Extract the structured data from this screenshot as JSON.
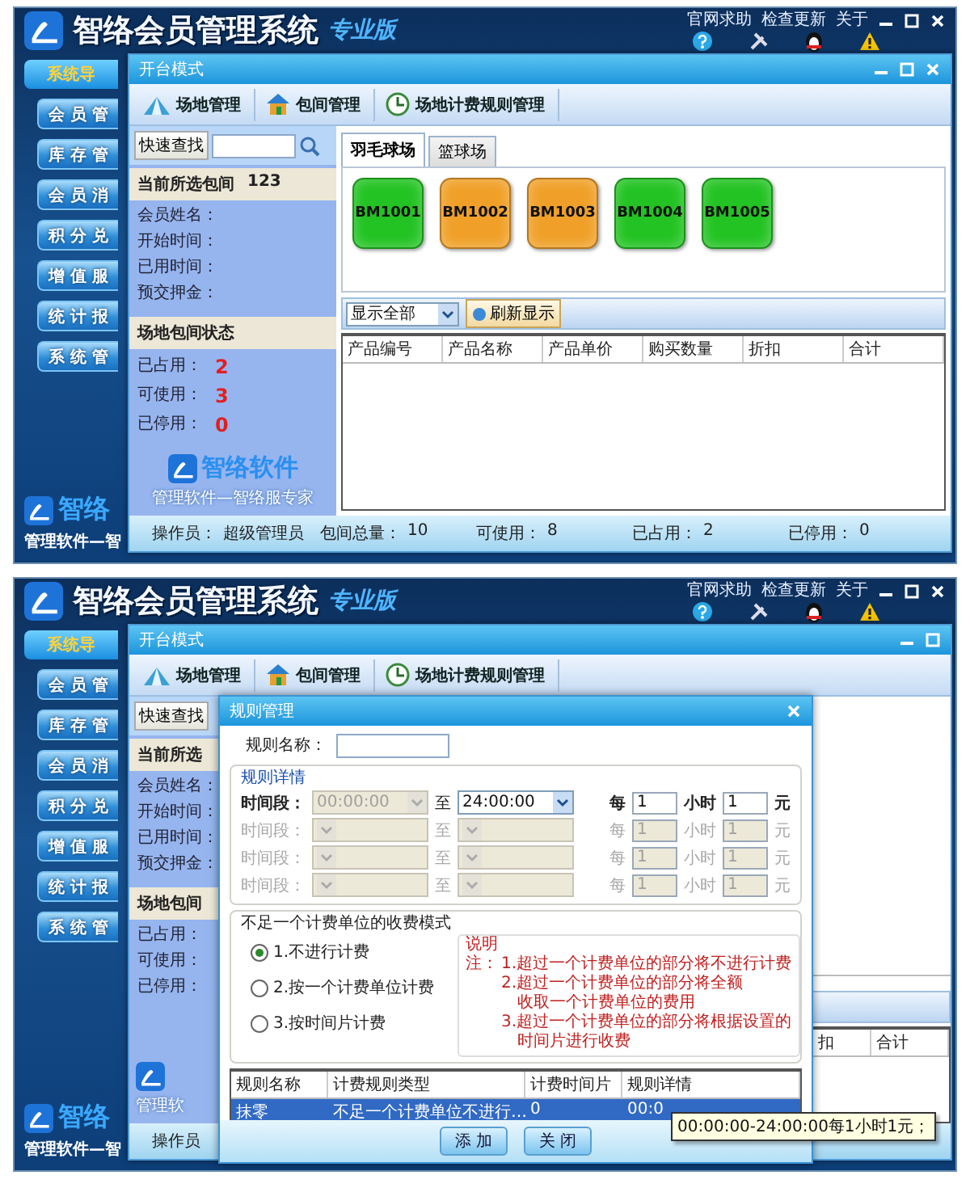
{
  "screens": [
    {
      "app": {
        "title": "智络会员管理系统",
        "edition": "专业版",
        "links": [
          "官网求助",
          "检查更新",
          "关于"
        ],
        "nav_header": "系统导",
        "nav": [
          "会 员 管",
          "库 存 管",
          "会 员 消",
          "积 分 兑",
          "增 值 服",
          "统 计 报",
          "系 统 管"
        ],
        "brand": "智络",
        "tagline": "管理软件—智"
      },
      "window": {
        "title": "开台模式",
        "toolbar": [
          "场地管理",
          "包间管理",
          "场地计费规则管理"
        ],
        "search_label": "快速查找",
        "current_label": "当前所选包间",
        "current_value": "123",
        "fields": [
          "会员姓名：",
          "开始时间：",
          "已用时间：",
          "预交押金："
        ],
        "status_header": "场地包间状态",
        "stats": [
          {
            "label": "已占用：",
            "value": "2"
          },
          {
            "label": "可使用：",
            "value": "3"
          },
          {
            "label": "已停用：",
            "value": "0"
          }
        ],
        "logo": "智络软件",
        "logo_tagline": "管理软件—智络服专家",
        "tabs": [
          {
            "label": "羽毛球场",
            "selected": true
          },
          {
            "label": "篮球场",
            "selected": false
          }
        ],
        "courts": [
          {
            "label": "BM1001",
            "color": "#22c322"
          },
          {
            "label": "BM1002",
            "color": "#f0a028"
          },
          {
            "label": "BM1003",
            "color": "#f0a028"
          },
          {
            "label": "BM1004",
            "color": "#22c322"
          },
          {
            "label": "BM1005",
            "color": "#22c322"
          }
        ],
        "filter": "显示全部",
        "refresh": "刷新显示",
        "columns": [
          "产品编号",
          "产品名称",
          "产品单价",
          "购买数量",
          "折扣",
          "合计"
        ],
        "status_bar": [
          {
            "label": "操作员：",
            "value": "超级管理员"
          },
          {
            "label": "包间总量：",
            "value": "10"
          },
          {
            "label": "可使用：",
            "value": "8"
          },
          {
            "label": "已占用：",
            "value": "2"
          },
          {
            "label": "已停用：",
            "value": "0"
          }
        ]
      }
    },
    {
      "app": {
        "title": "智络会员管理系统",
        "edition": "专业版",
        "links": [
          "官网求助",
          "检查更新",
          "关于"
        ],
        "nav_header": "系统导",
        "nav": [
          "会 员 管",
          "库 存 管",
          "会 员 消",
          "积 分 兑",
          "增 值 服",
          "统 计 报",
          "系 统 管"
        ],
        "brand": "智络",
        "tagline": "管理软件—智"
      },
      "window": {
        "title": "开台模式",
        "toolbar": [
          "场地管理",
          "包间管理",
          "场地计费规则管理"
        ],
        "search_label": "快速查找",
        "current_label": "当前所选",
        "fields": [
          "会员姓名：",
          "开始时间：",
          "已用时间：",
          "预交押金："
        ],
        "status_header": "场地包间",
        "stat_labels": [
          "已占用：",
          "可使用：",
          "已停用："
        ],
        "logo_tagline": "管理软",
        "columns": [
          "扣",
          "合计"
        ],
        "operator": "操作员"
      },
      "dialog": {
        "title": "规则管理",
        "name_label": "规则名称：",
        "details_legend": "规则详情",
        "periods": [
          {
            "label": "时间段：",
            "start": "00:00:00",
            "start_disabled": true,
            "to": "至",
            "end": "24:00:00",
            "per": "每",
            "hours": "1",
            "unit": "小时",
            "price": "1",
            "currency": "元",
            "disabled": false
          },
          {
            "label": "时间段：",
            "start_disabled": true,
            "to": "至",
            "per": "每",
            "hours": "1",
            "unit": "小时",
            "price": "1",
            "currency": "元",
            "disabled": true
          },
          {
            "label": "时间段：",
            "start_disabled": true,
            "to": "至",
            "per": "每",
            "hours": "1",
            "unit": "小时",
            "price": "1",
            "currency": "元",
            "disabled": true
          },
          {
            "label": "时间段：",
            "start_disabled": true,
            "to": "至",
            "per": "每",
            "hours": "1",
            "unit": "小时",
            "price": "1",
            "currency": "元",
            "disabled": true
          }
        ],
        "mode_legend": "不足一个计费单位的收费模式",
        "modes": [
          {
            "label": "1.不进行计费",
            "selected": true
          },
          {
            "label": "2.按一个计费单位计费",
            "selected": false
          },
          {
            "label": "3.按时间片计费",
            "selected": false
          }
        ],
        "notes_title": "说明",
        "notes_prefix": "注：",
        "notes": [
          [
            "1.超过一个计费单位的部分将不进行计费"
          ],
          [
            "2.超过一个计费单位的部分将全额",
            "收取一个计费单位的费用"
          ],
          [
            "3.超过一个计费单位的部分将根据设置的",
            "时间片进行收费"
          ]
        ],
        "columns": [
          "规则名称",
          "计费规则类型",
          "计费时间片",
          "规则详情"
        ],
        "rows": [
          {
            "cells": [
              "抹零",
              "不足一个计费单位不进行…",
              "0",
              "00:0"
            ],
            "selected": true
          }
        ],
        "tooltip": "00:00:00-24:00:00每1小时1元；",
        "buttons": [
          "添 加",
          "关 闭"
        ]
      }
    }
  ]
}
